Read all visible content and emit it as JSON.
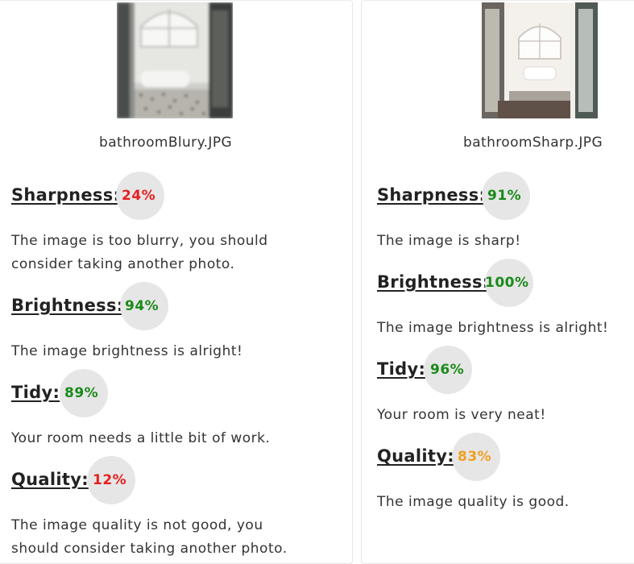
{
  "cards": [
    {
      "filename": "bathroomBlury.JPG",
      "image_alt": "bathroom-blurry-photo",
      "metrics": [
        {
          "label": "Sharpness:",
          "score": "24%",
          "desc_lines": [
            "The image is too blurry, you should",
            "consider taking another photo."
          ],
          "color": "#e82020"
        },
        {
          "label": "Brightness:",
          "score": "94%",
          "desc_lines": [
            "The image brightness is alright!"
          ],
          "color": "#1a8a1a"
        },
        {
          "label": "Tidy:",
          "score": "89%",
          "desc_lines": [
            "Your room needs a little bit of work."
          ],
          "color": "#1a8a1a"
        },
        {
          "label": "Quality:",
          "score": "12%",
          "desc_lines": [
            "The image quality is not good, you",
            "should consider taking another photo."
          ],
          "color": "#e82020"
        }
      ]
    },
    {
      "filename": "bathroomSharp.JPG",
      "image_alt": "bathroom-sharp-photo",
      "metrics": [
        {
          "label": "Sharpness:",
          "score": "91%",
          "desc_lines": [
            "The image is sharp!"
          ],
          "color": "#1a8a1a"
        },
        {
          "label": "Brightness:",
          "score": "100%",
          "desc_lines": [
            "The image brightness is alright!"
          ],
          "color": "#1a8a1a"
        },
        {
          "label": "Tidy:",
          "score": "96%",
          "desc_lines": [
            "Your room is very neat!"
          ],
          "color": "#1a8a1a"
        },
        {
          "label": "Quality:",
          "score": "83%",
          "desc_lines": [
            "The image quality is good."
          ],
          "color": "#f0a020"
        }
      ]
    }
  ]
}
